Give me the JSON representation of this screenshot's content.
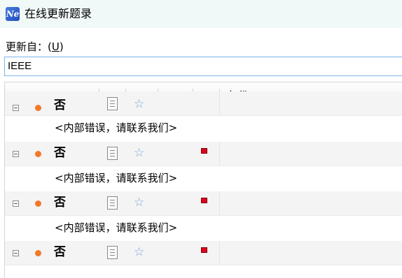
{
  "window": {
    "title": "在线更新题录",
    "app_icon_text": "Ne"
  },
  "form": {
    "update_from_label": "更新自：",
    "update_from_accel": "U",
    "source_value": "IEEE"
  },
  "grid": {
    "columns": [
      "",
      "",
      "",
      "",
      "",
      "",
      "年份"
    ],
    "rows": [
      {
        "status": "否",
        "message": "<内部错误，请联系我们>"
      },
      {
        "status": "否",
        "message": "<内部错误，请联系我们>"
      },
      {
        "status": "否",
        "message": "<内部错误，请联系我们>"
      },
      {
        "status": "否",
        "message": ""
      }
    ]
  },
  "colors": {
    "dot": "#f07a28",
    "flag": "#e0001a",
    "star": "#7aa4d8",
    "input_border": "#7eb4ea"
  }
}
